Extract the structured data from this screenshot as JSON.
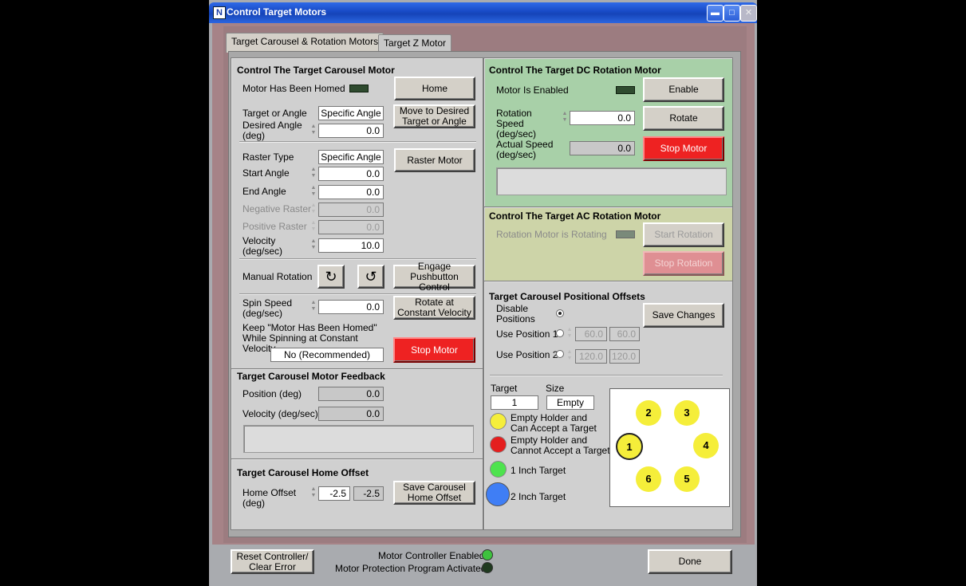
{
  "window": {
    "title": "Control Target Motors",
    "app_icon": "N"
  },
  "tabs": [
    {
      "label": "Target Carousel & Rotation Motors",
      "active": true
    },
    {
      "label": "Target Z Motor",
      "active": false
    }
  ],
  "carousel": {
    "title": "Control The Target Carousel Motor",
    "homed_label": "Motor Has Been Homed",
    "home_button": "Home",
    "target_or_angle_label": "Target or Angle",
    "target_or_angle_value": "Specific Angle",
    "move_button": "Move to Desired Target or Angle",
    "desired_angle_label": "Desired Angle (deg)",
    "desired_angle_value": "0.0",
    "raster_type_label": "Raster Type",
    "raster_type_value": "Specific Angle",
    "raster_button": "Raster Motor",
    "start_angle_label": "Start Angle",
    "start_angle_value": "0.0",
    "end_angle_label": "End Angle",
    "end_angle_value": "0.0",
    "neg_raster_label": "Negative Raster",
    "neg_raster_value": "0.0",
    "pos_raster_label": "Positive Raster",
    "pos_raster_value": "0.0",
    "velocity_label": "Velocity (deg/sec)",
    "velocity_value": "10.0",
    "manual_rotation_label": "Manual Rotation",
    "engage_button": "Engage Pushbutton Control",
    "spin_speed_label": "Spin Speed (deg/sec)",
    "spin_speed_value": "0.0",
    "rotate_const_button": "Rotate at Constant Velocity",
    "keep_homed_label": "Keep \"Motor Has Been Homed\" While Spinning at Constant Velocity",
    "keep_homed_value": "No (Recommended)",
    "stop_button": "Stop Motor"
  },
  "feedback": {
    "title": "Target Carousel Motor Feedback",
    "position_label": "Position  (deg)",
    "position_value": "0.0",
    "velocity_label": "Velocity (deg/sec)",
    "velocity_value": "0.0"
  },
  "home_offset": {
    "title": "Target Carousel Home Offset",
    "label": "Home Offset (deg)",
    "value": "-2.5",
    "current": "-2.5",
    "save_button": "Save Carousel Home Offset"
  },
  "dc_motor": {
    "title": "Control The Target DC Rotation Motor",
    "enabled_label": "Motor Is Enabled",
    "enable_button": "Enable",
    "speed_label": "Rotation Speed (deg/sec)",
    "speed_value": "0.0",
    "rotate_button": "Rotate",
    "actual_label": "Actual Speed (deg/sec)",
    "actual_value": "0.0",
    "stop_button": "Stop Motor"
  },
  "ac_motor": {
    "title": "Control The Target AC Rotation Motor",
    "rotating_label": "Rotation Motor is Rotating",
    "start_button": "Start Rotation",
    "stop_button": "Stop Rotation"
  },
  "offsets": {
    "title": "Target Carousel Positional Offsets",
    "disable_label": "Disable Positions",
    "save_button": "Save Changes",
    "pos1_label": "Use Position 1",
    "pos1_a": "60.0",
    "pos1_b": "60.0",
    "pos2_label": "Use Position 2",
    "pos2_a": "120.0",
    "pos2_b": "120.0",
    "target_label": "Target",
    "target_value": "1",
    "size_label": "Size",
    "size_value": "Empty",
    "legend": [
      {
        "text": "Empty Holder and Can Accept a Target",
        "color": "#f5ee3a"
      },
      {
        "text": "Empty Holder and Cannot Accept a Target",
        "color": "#e41e1e"
      },
      {
        "text": "1 Inch Target",
        "color": "#4ee34e"
      },
      {
        "text": "2 Inch Target",
        "color": "#3f7ef5"
      }
    ],
    "slots": [
      "1",
      "2",
      "3",
      "4",
      "5",
      "6"
    ]
  },
  "footer": {
    "reset_button": "Reset Controller/ Clear Error",
    "enabled_label": "Motor Controller Enabled",
    "protection_label": "Motor Protection Program Activated",
    "done_button": "Done"
  }
}
